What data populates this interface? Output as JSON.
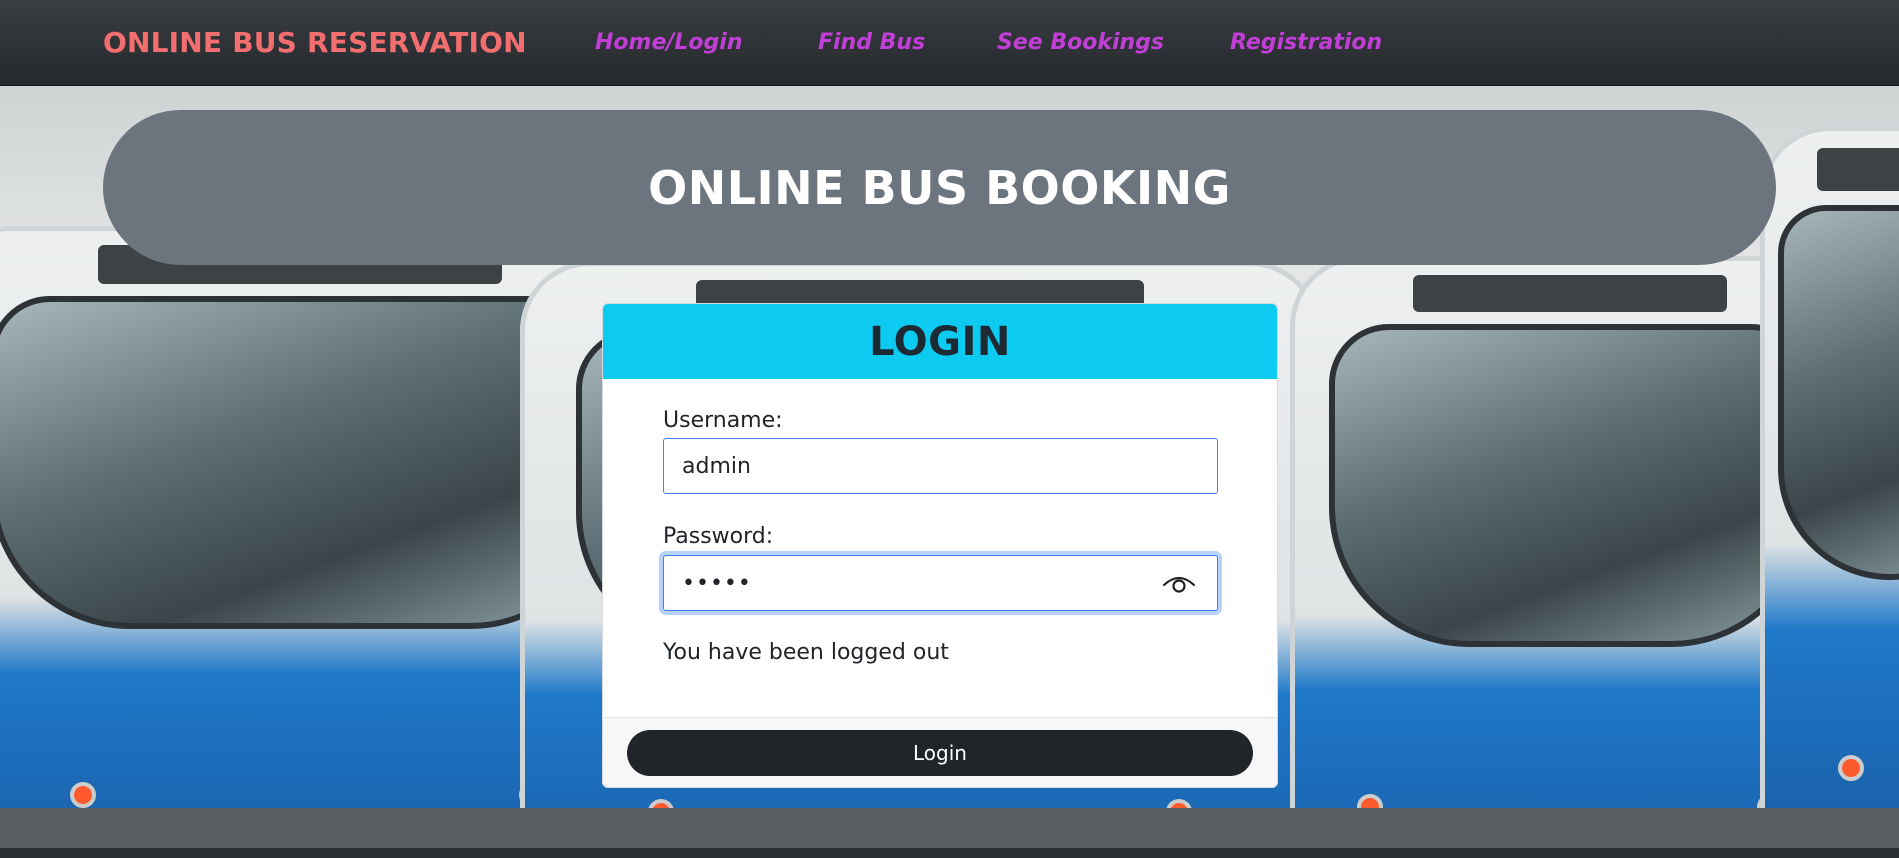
{
  "navbar": {
    "brand": "ONLINE BUS RESERVATION",
    "links": [
      {
        "label": "Home/Login"
      },
      {
        "label": "Find Bus"
      },
      {
        "label": "See Bookings"
      },
      {
        "label": "Registration"
      }
    ]
  },
  "banner": {
    "title": "ONLINE BUS BOOKING"
  },
  "login": {
    "title": "LOGIN",
    "username_label": "Username:",
    "username_value": "admin",
    "password_label": "Password:",
    "password_value": "admin",
    "password_toggle_icon": "eye-icon",
    "status_message": "You have been logged out",
    "submit_label": "Login"
  },
  "colors": {
    "brand": "#f36f6f",
    "nav_link": "#c13fd6",
    "banner_bg": "#6c757d",
    "card_header": "#0dcaf0",
    "button_bg": "#212529"
  }
}
